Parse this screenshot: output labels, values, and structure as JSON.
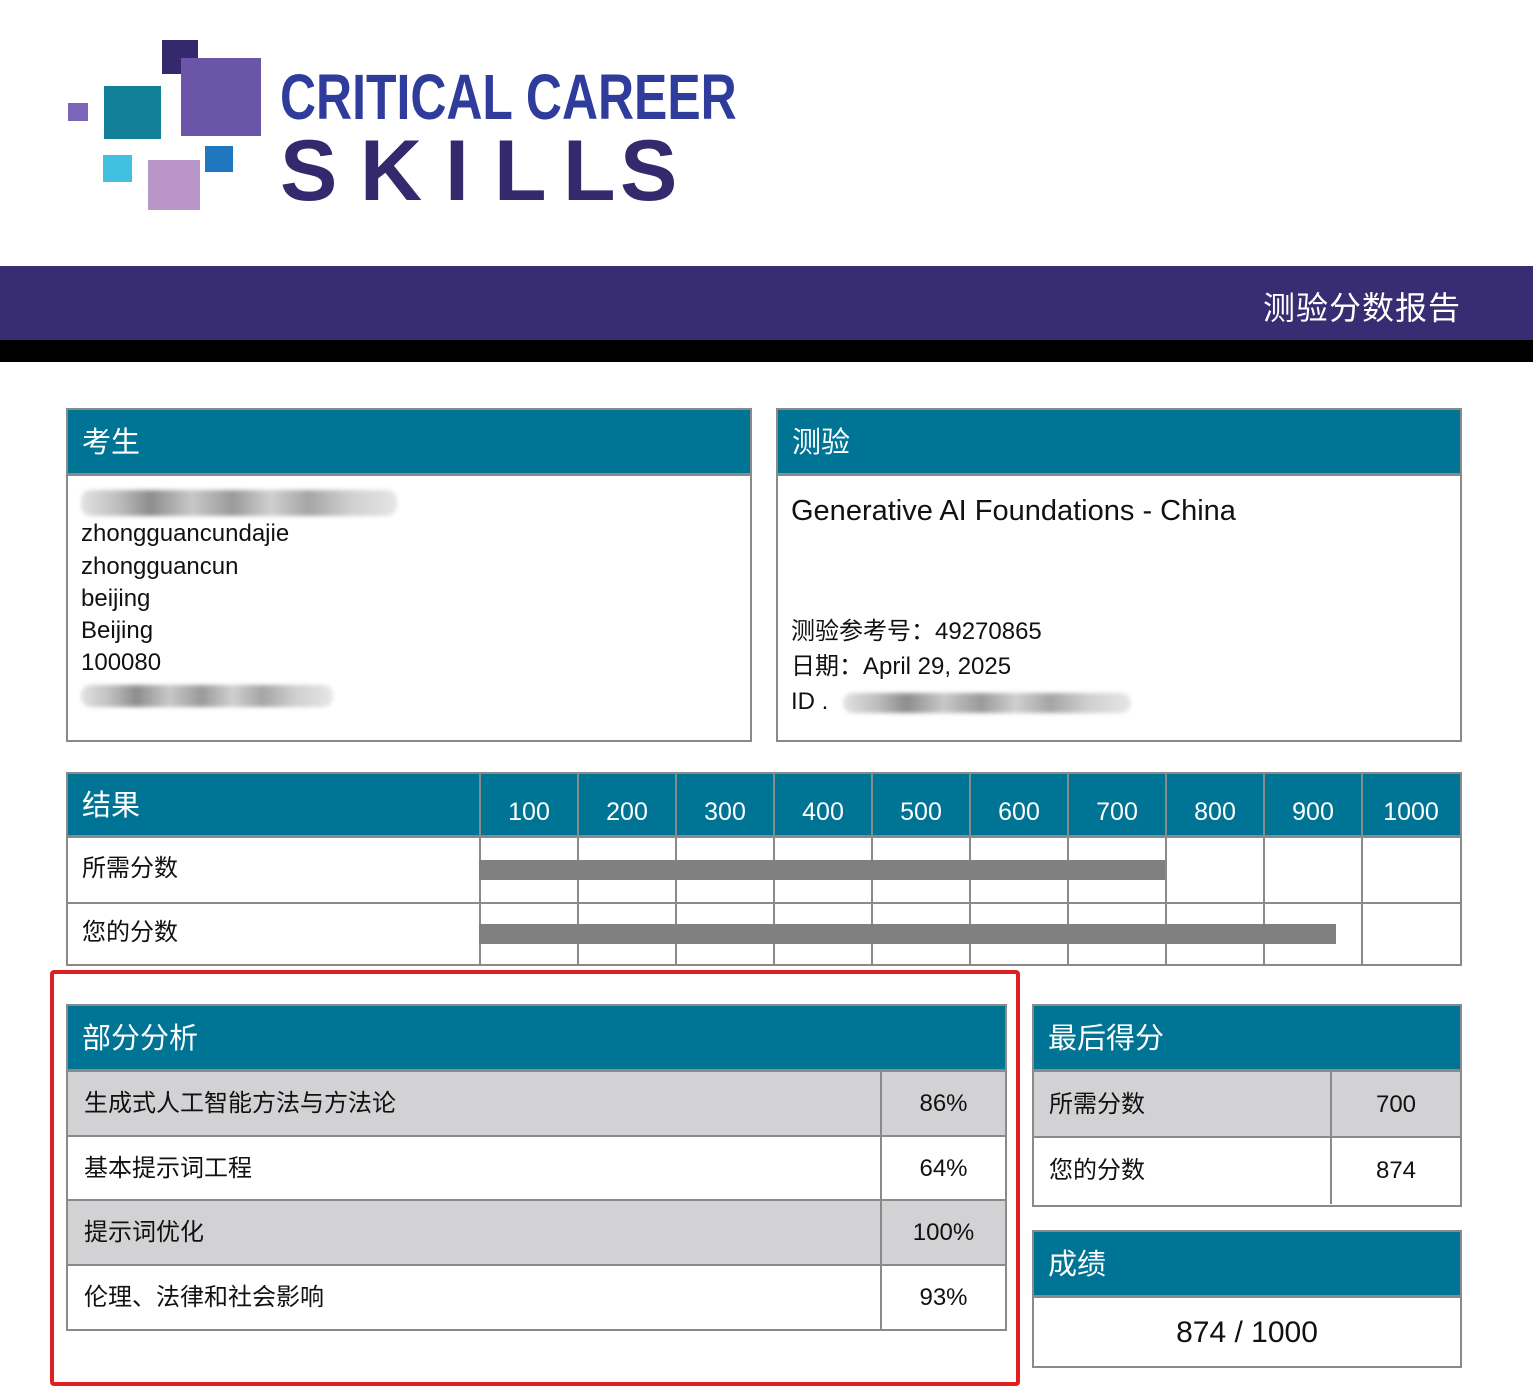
{
  "logo": {
    "line1": "CRITICAL CAREER",
    "line2_letters": [
      "S",
      "K",
      "I",
      "L",
      "L",
      "S"
    ],
    "colors": {
      "navy": "#35296d",
      "blue_text": "#2f3c9c",
      "teal": "#13809a",
      "purple": "#6a55a8",
      "light_blue": "#42c0e0",
      "lilac": "#b995c8",
      "mid_blue": "#1f78bf",
      "violet": "#7a65b8"
    }
  },
  "header": {
    "title": "测验分数报告",
    "bar_color": "#382c73"
  },
  "candidate": {
    "title": "考生",
    "address_lines": [
      "zhongguancundajie",
      "zhongguancun",
      "beijing",
      "Beijing",
      "100080"
    ]
  },
  "test": {
    "title": "测验",
    "name": "Generative AI Foundations - China",
    "reference_label": "测验参考号：",
    "reference_value": "49270865",
    "date_label": "日期：",
    "date_value": "April 29, 2025",
    "id_label": "ID ."
  },
  "results": {
    "title": "结果",
    "required_label": "所需分数",
    "your_label": "您的分数"
  },
  "chart_data": {
    "type": "bar",
    "orientation": "horizontal",
    "title": "结果",
    "x_ticks": [
      "100",
      "200",
      "300",
      "400",
      "500",
      "600",
      "700",
      "800",
      "900",
      "1000"
    ],
    "xlim": [
      0,
      1000
    ],
    "categories": [
      "所需分数",
      "您的分数"
    ],
    "values": [
      700,
      874
    ],
    "grid": true,
    "bar_color": "#808080"
  },
  "sections": {
    "title": "部分分析",
    "rows": [
      {
        "name": "生成式人工智能方法与方法论",
        "value": "86%"
      },
      {
        "name": "基本提示词工程",
        "value": "64%"
      },
      {
        "name": "提示词优化",
        "value": "100%"
      },
      {
        "name": "伦理、法律和社会影响",
        "value": "93%"
      }
    ]
  },
  "final_score": {
    "title": "最后得分",
    "required_label": "所需分数",
    "required_value": "700",
    "your_label": "您的分数",
    "your_value": "874"
  },
  "grade": {
    "title": "成绩",
    "value": "874 / 1000"
  },
  "theme": {
    "panel_header": "#007494",
    "border": "#8a8a8a",
    "row_shade": "#d2d2d4",
    "highlight": "#e02020"
  }
}
